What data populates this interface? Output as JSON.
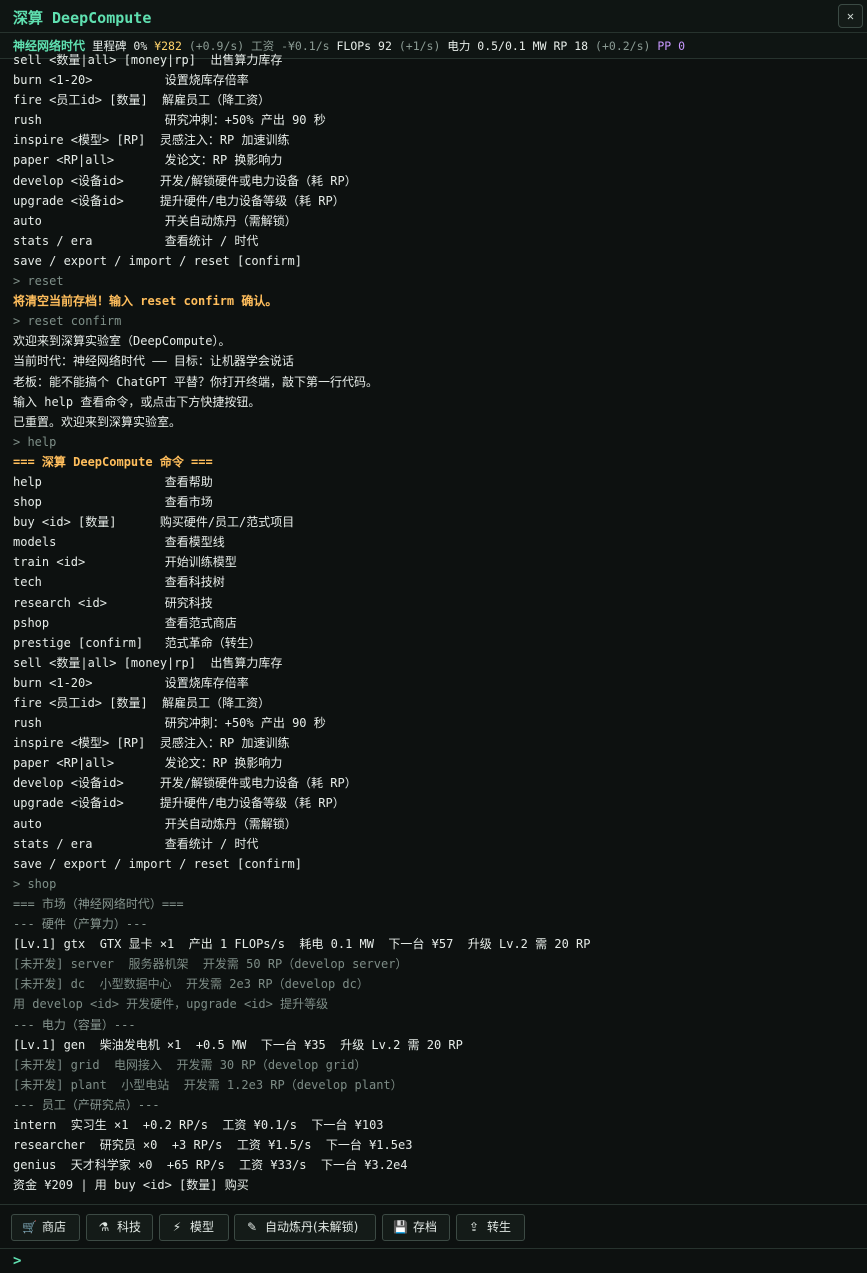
{
  "window": {
    "title": "深算 DeepCompute",
    "close_label": "✕"
  },
  "status": {
    "era": "神经网络时代",
    "milestone_label": "里程碑",
    "milestone_value": "0%",
    "money": "¥282",
    "money_rate": "(+0.9/s)",
    "wage": "工资 -¥0.1/s",
    "flops_label": "FLOPs",
    "flops_value": "92",
    "flops_rate": "(+1/s)",
    "power_label": "电力",
    "power_value": "0.5/0.1 MW",
    "rp_label": "RP",
    "rp_value": "18",
    "rp_rate": "(+0.2/s)",
    "pp": "PP 0"
  },
  "console": {
    "lines": [
      {
        "type": "cmd",
        "text": "sell <数量|all> [money|rp]  出售算力库存"
      },
      {
        "type": "cmd",
        "text": "burn <1-20>          设置烧库存倍率"
      },
      {
        "type": "cmd",
        "text": "fire <员工id> [数量]  解雇员工（降工资）"
      },
      {
        "type": "cmd",
        "text": "rush                 研究冲刺：+50% 产出 90 秒"
      },
      {
        "type": "cmd",
        "text": "inspire <模型> [RP]  灵感注入：RP 加速训练"
      },
      {
        "type": "cmd",
        "text": "paper <RP|all>       发论文：RP 换影响力"
      },
      {
        "type": "cmd",
        "text": "develop <设备id>     开发/解锁硬件或电力设备（耗 RP）"
      },
      {
        "type": "cmd",
        "text": "upgrade <设备id>     提升硬件/电力设备等级（耗 RP）"
      },
      {
        "type": "cmd",
        "text": "auto                 开关自动炼丹（需解锁）"
      },
      {
        "type": "cmd",
        "text": "stats / era          查看统计 / 时代"
      },
      {
        "type": "cmd",
        "text": "save / export / import / reset [confirm]"
      },
      {
        "type": "echo",
        "text": "> reset"
      },
      {
        "type": "warn",
        "text": "将清空当前存档！输入 reset confirm 确认。"
      },
      {
        "type": "echo",
        "text": "> reset confirm"
      },
      {
        "type": "text",
        "text": "欢迎来到深算实验室（DeepCompute）。"
      },
      {
        "type": "text",
        "text": "当前时代：神经网络时代 —— 目标：让机器学会说话"
      },
      {
        "type": "text",
        "text": "老板：能不能搞个 ChatGPT 平替？你打开终端，敲下第一行代码。"
      },
      {
        "type": "text",
        "text": "输入 help 查看命令，或点击下方快捷按钮。"
      },
      {
        "type": "text",
        "text": "已重置。欢迎来到深算实验室。"
      },
      {
        "type": "echo",
        "text": "> help"
      },
      {
        "type": "head",
        "text": "=== 深算 DeepCompute 命令 ==="
      },
      {
        "type": "cmd",
        "text": "help                 查看帮助"
      },
      {
        "type": "cmd",
        "text": "shop                 查看市场"
      },
      {
        "type": "cmd",
        "text": "buy <id> [数量]      购买硬件/员工/范式项目"
      },
      {
        "type": "cmd",
        "text": "models               查看模型线"
      },
      {
        "type": "cmd",
        "text": "train <id>           开始训练模型"
      },
      {
        "type": "cmd",
        "text": "tech                 查看科技树"
      },
      {
        "type": "cmd",
        "text": "research <id>        研究科技"
      },
      {
        "type": "cmd",
        "text": "pshop                查看范式商店"
      },
      {
        "type": "cmd",
        "text": "prestige [confirm]   范式革命（转生）"
      },
      {
        "type": "cmd",
        "text": "sell <数量|all> [money|rp]  出售算力库存"
      },
      {
        "type": "cmd",
        "text": "burn <1-20>          设置烧库存倍率"
      },
      {
        "type": "cmd",
        "text": "fire <员工id> [数量]  解雇员工（降工资）"
      },
      {
        "type": "cmd",
        "text": "rush                 研究冲刺：+50% 产出 90 秒"
      },
      {
        "type": "cmd",
        "text": "inspire <模型> [RP]  灵感注入：RP 加速训练"
      },
      {
        "type": "cmd",
        "text": "paper <RP|all>       发论文：RP 换影响力"
      },
      {
        "type": "cmd",
        "text": "develop <设备id>     开发/解锁硬件或电力设备（耗 RP）"
      },
      {
        "type": "cmd",
        "text": "upgrade <设备id>     提升硬件/电力设备等级（耗 RP）"
      },
      {
        "type": "cmd",
        "text": "auto                 开关自动炼丹（需解锁）"
      },
      {
        "type": "cmd",
        "text": "stats / era          查看统计 / 时代"
      },
      {
        "type": "cmd",
        "text": "save / export / import / reset [confirm]"
      },
      {
        "type": "echo",
        "text": "> shop"
      },
      {
        "type": "sub",
        "text": "=== 市场（神经网络时代）==="
      },
      {
        "type": "sub",
        "text": "--- 硬件（产算力）---"
      },
      {
        "type": "item",
        "text": "[Lv.1] gtx  GTX 显卡 ×1  产出 1 FLOPs/s  耗电 0.1 MW  下一台 ¥57  升级 Lv.2 需 20 RP"
      },
      {
        "type": "dim",
        "text": "[未开发] server  服务器机架  开发需 50 RP（develop server）"
      },
      {
        "type": "dim",
        "text": "[未开发] dc  小型数据中心  开发需 2e3 RP（develop dc）"
      },
      {
        "type": "dim",
        "text": "用 develop <id> 开发硬件，upgrade <id> 提升等级"
      },
      {
        "type": "sub",
        "text": "--- 电力（容量）---"
      },
      {
        "type": "item",
        "text": "[Lv.1] gen  柴油发电机 ×1  +0.5 MW  下一台 ¥35  升级 Lv.2 需 20 RP"
      },
      {
        "type": "dim",
        "text": "[未开发] grid  电网接入  开发需 30 RP（develop grid）"
      },
      {
        "type": "dim",
        "text": "[未开发] plant  小型电站  开发需 1.2e3 RP（develop plant）"
      },
      {
        "type": "sub",
        "text": "--- 员工（产研究点）---"
      },
      {
        "type": "item",
        "text": "intern  实习生 ×1  +0.2 RP/s  工资 ¥0.1/s  下一台 ¥103"
      },
      {
        "type": "item",
        "text": "researcher  研究员 ×0  +3 RP/s  工资 ¥1.5/s  下一台 ¥1.5e3"
      },
      {
        "type": "item",
        "text": "genius  天才科学家 ×0  +65 RP/s  工资 ¥33/s  下一台 ¥3.2e4"
      },
      {
        "type": "item",
        "text": "资金 ¥209 | 用 buy <id> [数量] 购买"
      }
    ]
  },
  "toolbar": {
    "shop": {
      "icon": "🛒",
      "label": "商店"
    },
    "tech": {
      "icon": "⚗",
      "label": "科技"
    },
    "model": {
      "icon": "⚡",
      "label": "模型"
    },
    "auto": {
      "icon": "✎",
      "label": "自动炼丹(未解锁)"
    },
    "save": {
      "icon": "💾",
      "label": "存档"
    },
    "prestige": {
      "icon": "⇪",
      "label": "转生"
    }
  },
  "prompt": {
    "sign": ">",
    "value": "",
    "placeholder": ""
  }
}
